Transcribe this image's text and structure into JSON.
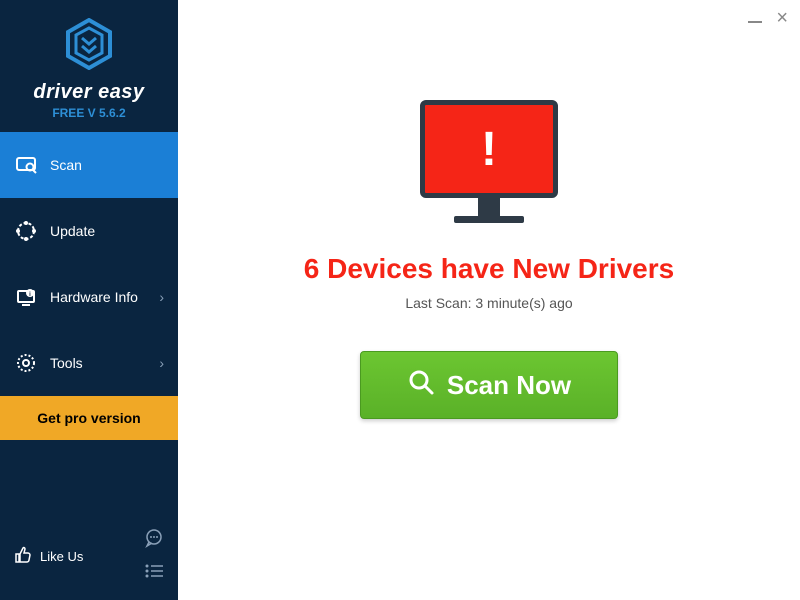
{
  "brand": {
    "name": "driver easy",
    "version": "FREE V 5.6.2"
  },
  "sidebar": {
    "items": [
      {
        "label": "Scan",
        "icon": "scan-icon",
        "active": true,
        "expandable": false
      },
      {
        "label": "Update",
        "icon": "update-icon",
        "active": false,
        "expandable": false
      },
      {
        "label": "Hardware Info",
        "icon": "hardware-info-icon",
        "active": false,
        "expandable": true
      },
      {
        "label": "Tools",
        "icon": "tools-icon",
        "active": false,
        "expandable": true
      }
    ],
    "pro": "Get pro version",
    "like": "Like Us"
  },
  "main": {
    "headline": "6 Devices have New Drivers",
    "subline": "Last Scan: 3 minute(s) ago",
    "scan_button": "Scan Now"
  },
  "status": {
    "devices_with_new_drivers": 6,
    "last_scan_minutes_ago": 3
  },
  "colors": {
    "sidebar_bg": "#0a2540",
    "accent_blue": "#1b7fd6",
    "accent_orange": "#f0a826",
    "alert_red": "#f52517",
    "scan_green": "#5ab128"
  }
}
